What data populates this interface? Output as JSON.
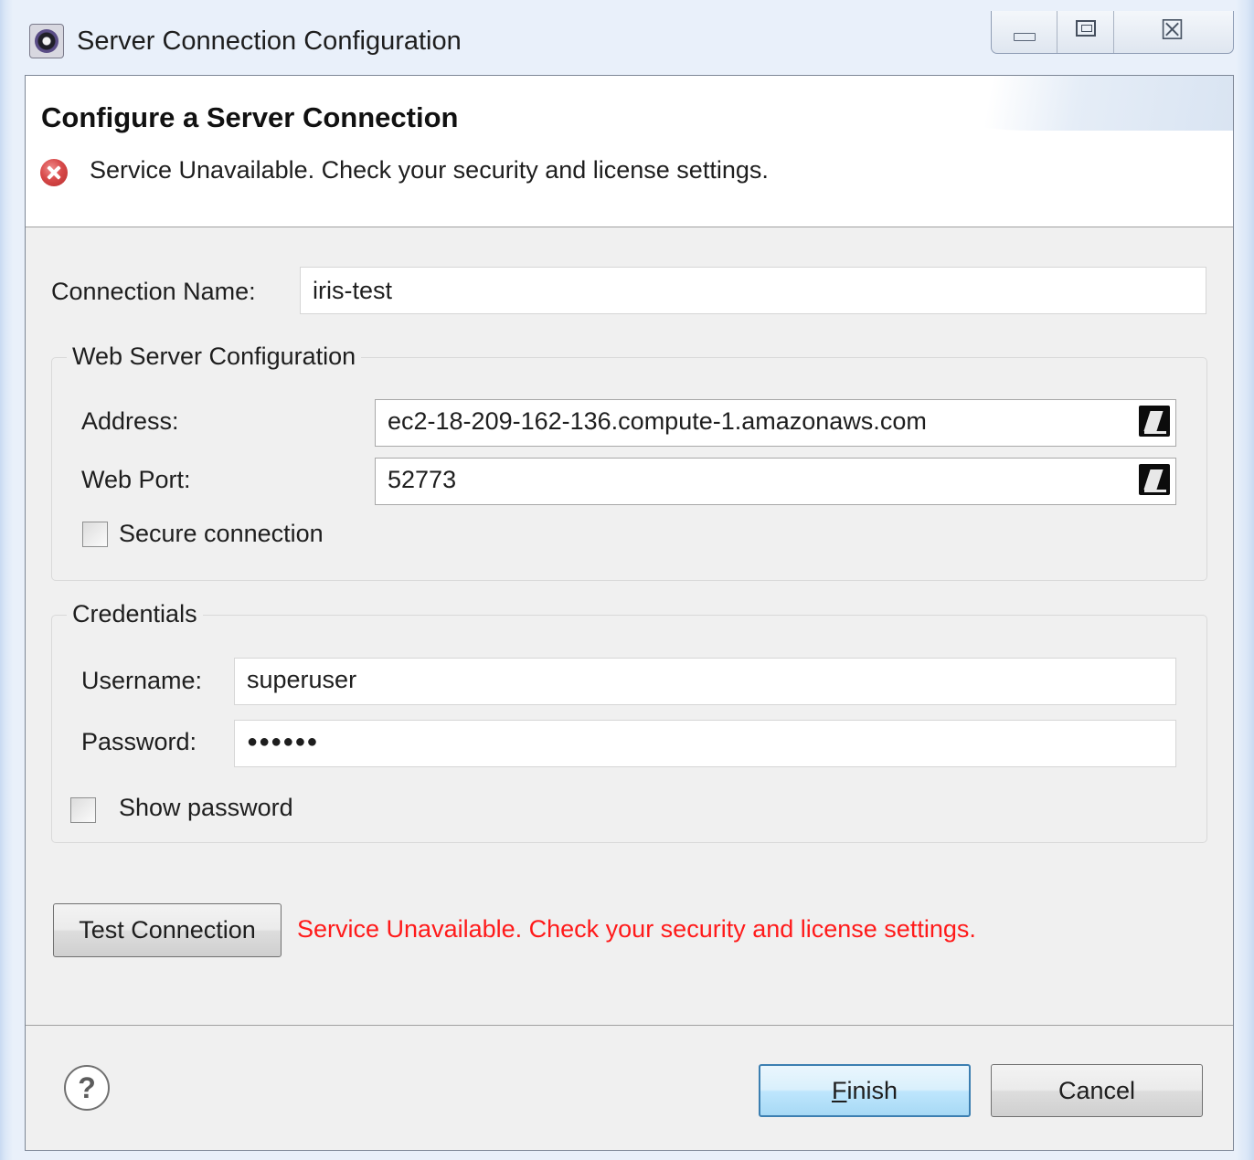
{
  "window": {
    "title": "Server Connection Configuration",
    "icon": "eclipse-gear-icon",
    "controls": {
      "minimize_icon": "minimize-icon",
      "maximize_icon": "maximize-icon",
      "close_icon": "close-icon",
      "close_glyph": "☒"
    }
  },
  "header": {
    "title": "Configure a Server Connection",
    "message_icon": "error-icon",
    "message": "Service Unavailable. Check your security and license settings."
  },
  "connection": {
    "name_label": "Connection Name:",
    "name_value": "iris-test"
  },
  "web_server": {
    "legend": "Web Server Configuration",
    "address_label": "Address:",
    "address_value": "ec2-18-209-162-136.compute-1.amazonaws.com",
    "port_label": "Web Port:",
    "port_value": "52773",
    "variables_icon": "variables-icon",
    "secure_label": "Secure connection",
    "secure_checked": false
  },
  "credentials": {
    "legend": "Credentials",
    "username_label": "Username:",
    "username_value": "superuser",
    "password_label": "Password:",
    "password_mask": "●●●●●●",
    "show_password_label": "Show password",
    "show_password_checked": false
  },
  "test": {
    "button_label": "Test Connection",
    "status_text": "Service Unavailable. Check your security and license settings.",
    "status_color": "#ff1a1a"
  },
  "footer": {
    "help_glyph": "?",
    "finish_mnemonic": "F",
    "finish_rest": "inish",
    "cancel_label": "Cancel"
  },
  "colors": {
    "dialog_bg": "#f0f0f0",
    "default_button_border": "#3c7fb1",
    "error_red": "#d84a4a"
  }
}
